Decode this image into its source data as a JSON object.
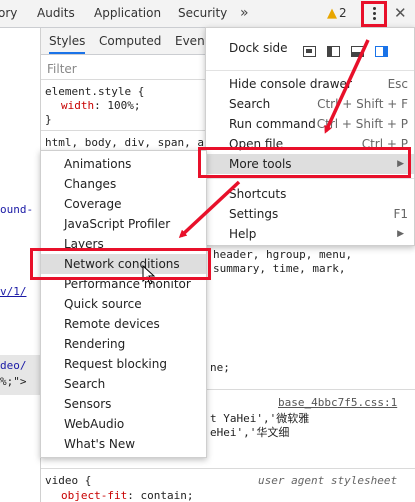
{
  "topbar": {
    "tabs": [
      "ory",
      "Audits",
      "Application",
      "Security"
    ],
    "more_icon": "chevrons-right-icon",
    "warnings_count": "2",
    "menu_icon": "kebab-icon",
    "close_icon": "close-icon"
  },
  "left_fragments": [
    "ound-",
    "v/1/",
    "deo/",
    "%;\">"
  ],
  "styles": {
    "tabs": [
      "Styles",
      "Computed",
      "Event"
    ],
    "filter_placeholder": "Filter",
    "element_style_selector": "element.style {",
    "element_style_prop": "width",
    "element_style_value": "100%;",
    "element_style_close": "}",
    "html_selector": "html, body, div, span, a",
    "partial_rule_1": "header, hgroup, menu,",
    "partial_rule_2": "summary, time, mark,",
    "partial_rule_3": "ne;",
    "source_link": "base_4bbc7f5.css:1",
    "font_frag_1": "t YaHei','微软雅",
    "font_frag_2": "eHei','华文细",
    "video_selector": "video {",
    "ua_label": "user agent stylesheet",
    "video_prop": "object-fit",
    "video_value": "contain;"
  },
  "main_menu": {
    "dock_side_label": "Dock side",
    "items": [
      {
        "label": "Hide console drawer",
        "shortcut": "Esc"
      },
      {
        "label": "Search",
        "shortcut": "Ctrl + Shift + F"
      },
      {
        "label": "Run command",
        "shortcut": "Ctrl + Shift + P"
      },
      {
        "label": "Open file",
        "shortcut": "Ctrl + P"
      },
      {
        "label": "More tools",
        "shortcut": ""
      },
      {
        "label": "Shortcuts",
        "shortcut": ""
      },
      {
        "label": "Settings",
        "shortcut": "F1"
      },
      {
        "label": "Help",
        "shortcut": ""
      }
    ]
  },
  "more_tools_menu": {
    "items": [
      "Animations",
      "Changes",
      "Coverage",
      "JavaScript Profiler",
      "Layers",
      "Network conditions",
      "Performance monitor",
      "Quick source",
      "Remote devices",
      "Rendering",
      "Request blocking",
      "Search",
      "Sensors",
      "WebAudio",
      "What's New"
    ],
    "highlighted": "Network conditions"
  },
  "colors": {
    "annotation_red": "#e8102a",
    "accent_blue": "#1a73e8"
  }
}
